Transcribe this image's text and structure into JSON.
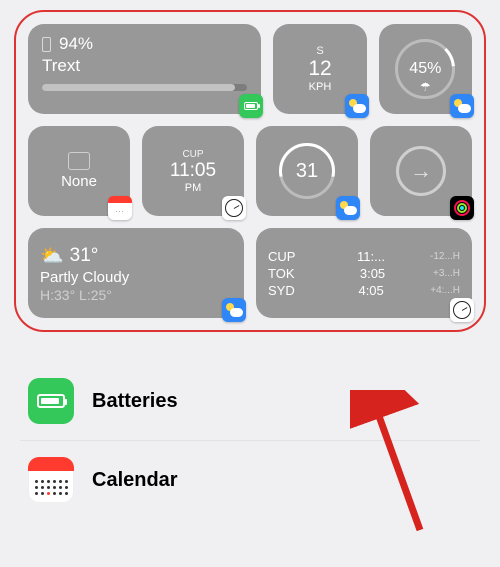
{
  "gallery": {
    "battery": {
      "percent": "94%",
      "device": "Trext"
    },
    "wind": {
      "dir": "S",
      "speed": "12",
      "unit": "KPH"
    },
    "rain": {
      "percent": "45%"
    },
    "calendar": {
      "label": "None"
    },
    "clock": {
      "city": "CUP",
      "time": "11:05",
      "ampm": "PM"
    },
    "temp": {
      "value": "31"
    },
    "weather_wide": {
      "temp": "31°",
      "cond": "Partly Cloudy",
      "hilo": "H:33° L:25°"
    },
    "world_clock": [
      {
        "city": "CUP",
        "time": "11:...",
        "diff": "-12...H"
      },
      {
        "city": "TOK",
        "time": "3:05",
        "diff": "+3...H"
      },
      {
        "city": "SYD",
        "time": "4:05",
        "diff": "+4:...H"
      }
    ]
  },
  "list": {
    "batteries": "Batteries",
    "calendar": "Calendar"
  }
}
